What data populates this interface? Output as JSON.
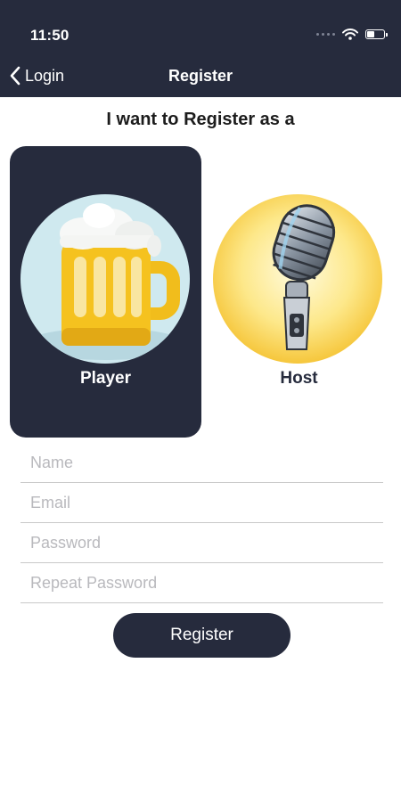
{
  "status_bar": {
    "time": "11:50"
  },
  "nav": {
    "back_label": "Login",
    "title": "Register"
  },
  "heading": "I want to Register as a",
  "roles": [
    {
      "label": "Player",
      "icon": "beer-mug-icon",
      "selected": true
    },
    {
      "label": "Host",
      "icon": "microphone-icon",
      "selected": false
    }
  ],
  "form": {
    "name_placeholder": "Name",
    "email_placeholder": "Email",
    "password_placeholder": "Password",
    "repeat_password_placeholder": "Repeat Password"
  },
  "register_button_label": "Register",
  "colors": {
    "primary": "#262b3d",
    "background": "#ffffff",
    "divider": "#c9c9c9"
  }
}
